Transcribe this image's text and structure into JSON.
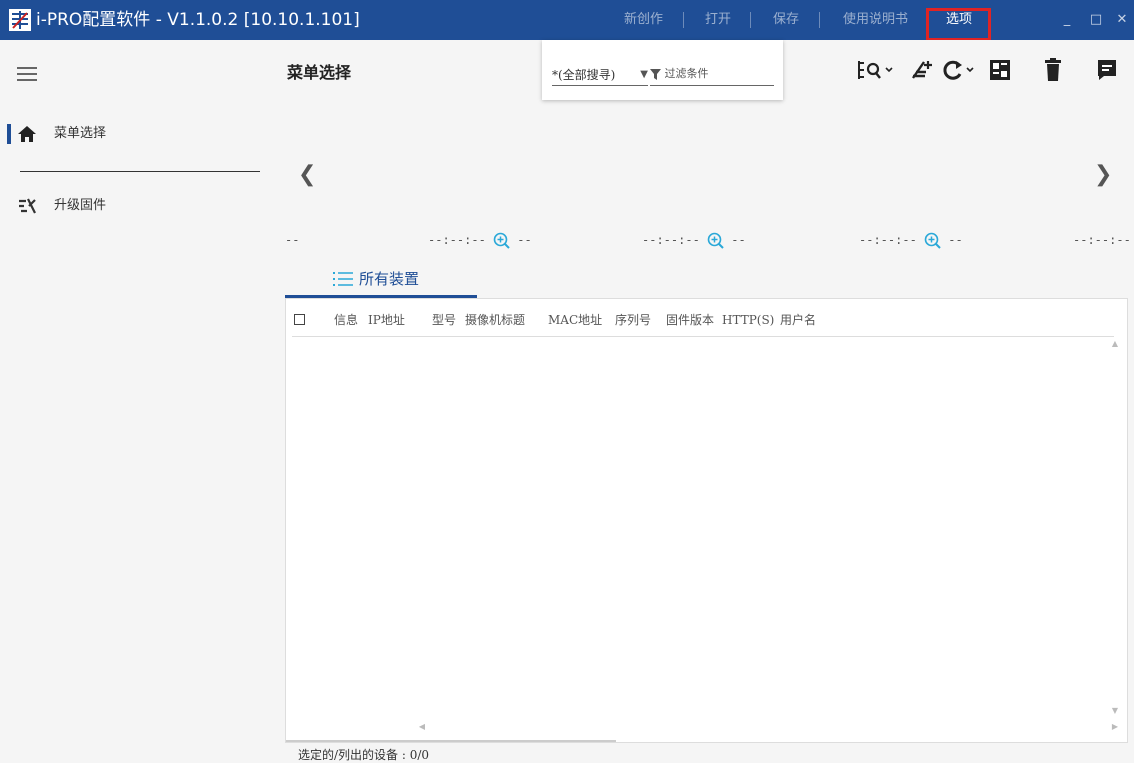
{
  "titlebar": {
    "title": "i-PRO配置软件 - V1.1.0.2 [10.10.1.101]",
    "menu": {
      "new": "新创作",
      "open": "打开",
      "save": "保存",
      "manual": "使用说明书",
      "options": "选项"
    },
    "minimize": "_",
    "maximize": "□",
    "close": "✕",
    "bg_color": "#1f4e96"
  },
  "sidebar": {
    "items": [
      {
        "label": "菜单选择",
        "icon": "home-icon",
        "active": true
      },
      {
        "label": "升级固件",
        "icon": "upgrade-firmware-icon",
        "active": false
      }
    ]
  },
  "main": {
    "page_title": "菜单选择",
    "search": {
      "scope": "*(全部搜寻)",
      "filter_placeholder": "过滤条件"
    },
    "timeline": {
      "first": "--",
      "items": [
        "--:--:-- ",
        "--:--:-- ",
        "--:--:-- ",
        "--:--:-- "
      ],
      "tail": " --"
    },
    "tab_label": "所有装置",
    "table": {
      "columns": [
        "信息",
        "IP地址",
        "型号",
        "摄像机标题",
        "MAC地址",
        "序列号",
        "固件版本",
        "HTTP(S)",
        "用户名"
      ]
    },
    "status": {
      "label": "选定的/列出的设备 : ",
      "value": "0/0"
    }
  }
}
